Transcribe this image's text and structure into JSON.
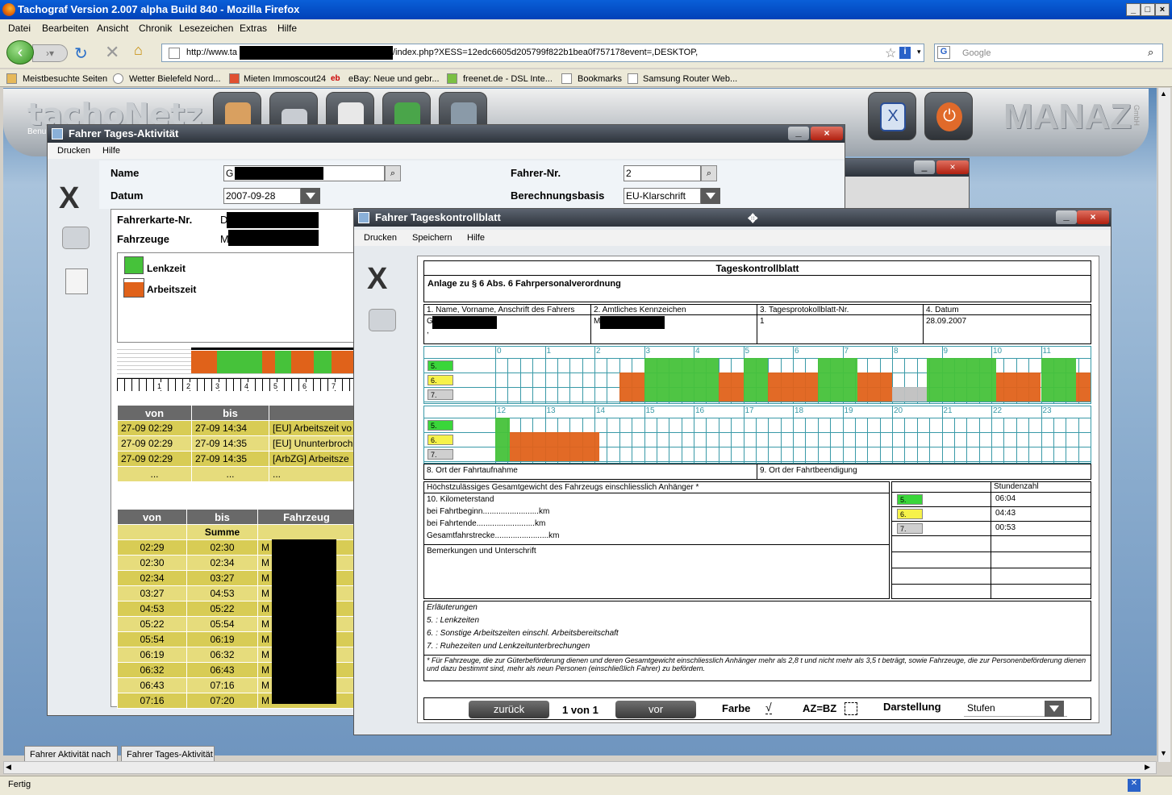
{
  "browser": {
    "title": "Tachograf Version 2.007 alpha Build 840 - Mozilla Firefox",
    "menu": [
      "Datei",
      "Bearbeiten",
      "Ansicht",
      "Chronik",
      "Lesezeichen",
      "Extras",
      "Hilfe"
    ],
    "url_prefix": "http://www.ta",
    "url_suffix": "/index.php?XESS=12edc6605d205799f822b1bea0f757178event=,DESKTOP,",
    "search_placeholder": "Google",
    "bookmarks": [
      "Meistbesuchte Seiten",
      "Wetter Bielefeld Nord...",
      "Mieten Immoscout24",
      "eBay: Neue und gebr...",
      "freenet.de - DSL Inte...",
      "Bookmarks",
      "Samsung Router Web..."
    ],
    "status": "Fertig",
    "tabs": [
      "Fahrer Aktivität nach",
      "Fahrer Tages-Aktivität"
    ]
  },
  "app": {
    "logo": "tachoNetz",
    "brand": "MANAZ",
    "brand_small": "GmbH",
    "logo_sub": "Benu"
  },
  "win1": {
    "title": "Fahrer Tages-Aktivität",
    "menu": [
      "Drucken",
      "Hilfe"
    ],
    "name_label": "Name",
    "name_value": "G",
    "datum_label": "Datum",
    "datum_value": "2007-09-28",
    "fahrer_label": "Fahrer-Nr.",
    "fahrer_value": "2",
    "basis_label": "Berechnungsbasis",
    "basis_value": "EU-Klarschrift",
    "karte_label": "Fahrerkarte-Nr.",
    "karte_value": "D",
    "fahrzeuge_label": "Fahrzeuge",
    "fahrzeuge_value": "M",
    "legend": [
      {
        "label": "Lenkzeit",
        "color": "#46c23a"
      },
      {
        "label": "Arbeitszeit",
        "color": "#e0621a"
      }
    ],
    "scale": [
      "1",
      "2",
      "3",
      "4",
      "5",
      "6",
      "7"
    ],
    "table1": {
      "headers": [
        "von",
        "bis",
        ""
      ],
      "rows": [
        [
          "27-09 02:29",
          "27-09 14:34",
          "[EU] Arbeitszeit vo"
        ],
        [
          "27-09 02:29",
          "27-09 14:35",
          "[EU] Ununterbroch"
        ],
        [
          "27-09 02:29",
          "27-09 14:35",
          "[ArbZG] Arbeitsze"
        ],
        [
          "...",
          "...",
          "..."
        ]
      ]
    },
    "table2": {
      "headers": [
        "von",
        "bis",
        "Fahrzeug"
      ],
      "summe": "Summe",
      "rows": [
        [
          "02:29",
          "02:30",
          "M"
        ],
        [
          "02:30",
          "02:34",
          "M"
        ],
        [
          "02:34",
          "03:27",
          "M"
        ],
        [
          "03:27",
          "04:53",
          "M"
        ],
        [
          "04:53",
          "05:22",
          "M"
        ],
        [
          "05:22",
          "05:54",
          "M"
        ],
        [
          "05:54",
          "06:19",
          "M"
        ],
        [
          "06:19",
          "06:32",
          "M"
        ],
        [
          "06:32",
          "06:43",
          "M"
        ],
        [
          "06:43",
          "07:16",
          "M"
        ],
        [
          "07:16",
          "07:20",
          "M"
        ]
      ]
    }
  },
  "win2": {
    "title": "Fahrer Tageskontrollblatt",
    "menu": [
      "Drucken",
      "Speichern",
      "Hilfe"
    ],
    "doc_title": "Tageskontrollblatt",
    "doc_subtitle": "Anlage zu § 6 Abs. 6 Fahrpersonalverordnung",
    "h1": "1. Name, Vorname, Anschrift des Fahrers",
    "h2": "2. Amtliches Kennzeichen",
    "h3": "3. Tagesprotokollblatt-Nr.",
    "h4": "4. Datum",
    "v1": "G",
    "v1b": ",",
    "v2": "M",
    "v3": "1",
    "v4": "28.09.2007",
    "hours_top": [
      "0",
      "1",
      "2",
      "3",
      "4",
      "5",
      "6",
      "7",
      "8",
      "9",
      "10",
      "11"
    ],
    "hours_bottom": [
      "12",
      "13",
      "14",
      "15",
      "16",
      "17",
      "18",
      "19",
      "20",
      "21",
      "22",
      "23"
    ],
    "row_labels": [
      "5.",
      "6.",
      "7."
    ],
    "ort_start": "8. Ort der Fahrtaufnahme",
    "ort_end": "9. Ort der Fahrtbeendigung",
    "gewicht": "Höchstzulässiges Gesamtgewicht des Fahrzeugs einschliesslich Anhänger *",
    "km_title": "10. Kilometerstand",
    "km_begin": "bei Fahrtbeginn.........................km",
    "km_end": "bei Fahrtende..........................km",
    "km_total": "Gesamtfahrstrecke........................km",
    "bemerkungen": "Bemerkungen und Unterschrift",
    "stundenzahl": "Stundenzahl",
    "hours_sum": [
      "06:04",
      "04:43",
      "00:53"
    ],
    "erl_title": "Erläuterungen",
    "erl": [
      "5. : Lenkzeiten",
      "6. : Sonstige Arbeitszeiten einschl. Arbeitsbereitschaft",
      "7. : Ruhezeiten und Lenkzeitunterbrechungen"
    ],
    "footnote": "* Für Fahrzeuge, die zur Güterbeförderung dienen und deren Gesamtgewicht einschliesslich Anhänger mehr als 2,8 t und nicht mehr als 3,5 t beträgt, sowie Fahrzeuge, die zur Personenbeförderung dienen und dazu bestimmt sind, mehr als neun Personen (einschließlich Fahrer) zu befördern.",
    "prev": "zurück",
    "page": "1 von 1",
    "next": "vor",
    "farbe": "Farbe",
    "farbe_check": "√",
    "azbz": "AZ=BZ",
    "darstellung": "Darstellung",
    "stufen": "Stufen"
  }
}
